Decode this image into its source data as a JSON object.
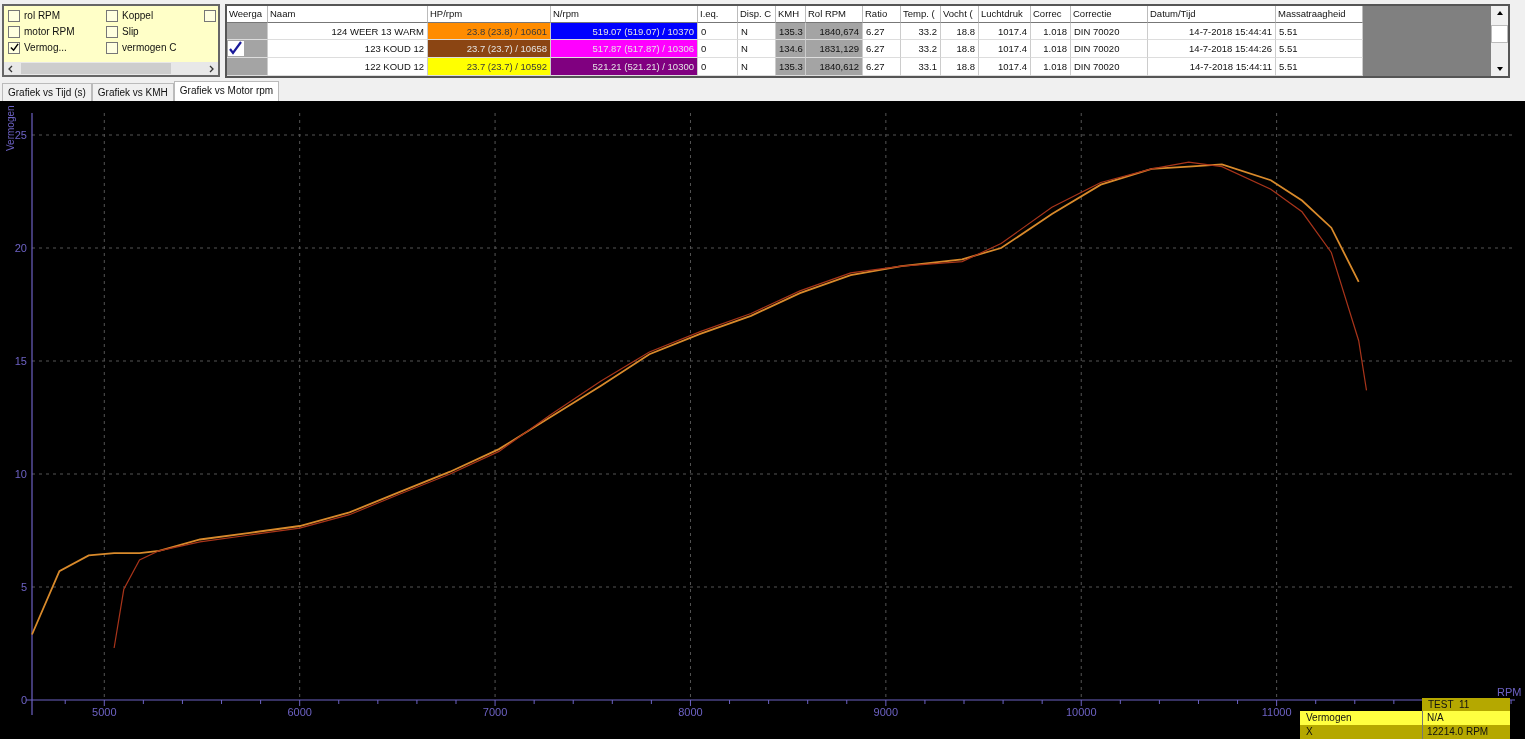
{
  "curve_panel": {
    "columns": [
      [
        {
          "label": "rol RPM",
          "checked": false
        },
        {
          "label": "motor RPM",
          "checked": false
        },
        {
          "label": "Vermog...",
          "checked": true
        }
      ],
      [
        {
          "label": "Koppel",
          "checked": false
        },
        {
          "label": "Slip",
          "checked": false
        },
        {
          "label": "vermogen C",
          "checked": false
        }
      ],
      [
        {
          "checked": false
        }
      ]
    ]
  },
  "runs_table": {
    "columns": [
      "Weerga",
      "Naam",
      "HP/rpm",
      "N/rpm",
      "I.eq.",
      "Disp. C",
      "KMH",
      "Rol RPM",
      "Ratio",
      "Temp. (",
      "Vocht (",
      "Luchtdruk",
      "Correc",
      "Correctie",
      "Datum/Tijd",
      "Massatraagheid"
    ],
    "rows": [
      {
        "checked": false,
        "naam": "124 WEER 13 WARM",
        "hp": {
          "text": "23.8 (23.8) / 10601",
          "color": "#ff8c00"
        },
        "nrpm": {
          "text": "519.07 (519.07) / 10370",
          "color": "#0000ff"
        },
        "ieq": "0",
        "disp": "N",
        "kmh": "135.3",
        "rol_rpm": "1840,674",
        "ratio": "6.27",
        "temp": "33.2",
        "vocht": "18.8",
        "luchtdruk": "1017.4",
        "correc": "1.018",
        "correctie": "DIN 70020",
        "datum": "14-7-2018 15:44:41",
        "massa": "5.51"
      },
      {
        "checked": true,
        "naam": "123 KOUD 12",
        "hp": {
          "text": "23.7 (23.7) / 10658",
          "color": "#8b4513"
        },
        "nrpm": {
          "text": "517.87 (517.87) / 10306",
          "color": "#ff00ff"
        },
        "ieq": "0",
        "disp": "N",
        "kmh": "134.6",
        "rol_rpm": "1831,129",
        "ratio": "6.27",
        "temp": "33.2",
        "vocht": "18.8",
        "luchtdruk": "1017.4",
        "correc": "1.018",
        "correctie": "DIN 70020",
        "datum": "14-7-2018 15:44:26",
        "massa": "5.51"
      },
      {
        "checked": false,
        "naam": "122 KOUD 12",
        "hp": {
          "text": "23.7 (23.7) / 10592",
          "color": "#ffff00"
        },
        "nrpm": {
          "text": "521.21 (521.21) / 10300",
          "color": "#800080"
        },
        "ieq": "0",
        "disp": "N",
        "kmh": "135.3",
        "rol_rpm": "1840,612",
        "ratio": "6.27",
        "temp": "33.1",
        "vocht": "18.8",
        "luchtdruk": "1017.4",
        "correc": "1.018",
        "correctie": "DIN 70020",
        "datum": "14-7-2018 15:44:11",
        "massa": "5.51"
      }
    ]
  },
  "tabs": [
    {
      "label": "Grafiek vs Tijd (s)",
      "selected": false
    },
    {
      "label": "Grafiek vs KMH",
      "selected": false
    },
    {
      "label": "Grafiek vs Motor rpm",
      "selected": true
    }
  ],
  "chart_data": {
    "type": "line",
    "grid": true,
    "xlabel": "RPM",
    "ylabel": "Vermogen",
    "xlim": [
      4630,
      12220
    ],
    "ylim": [
      0,
      26
    ],
    "xticks": [
      5000,
      6000,
      7000,
      8000,
      9000,
      10000,
      11000
    ],
    "yticks": [
      0,
      5,
      10,
      15,
      20,
      25
    ],
    "x": [
      4630,
      4770,
      4920,
      5050,
      5100,
      5180,
      5280,
      5490,
      5745,
      6000,
      6255,
      6510,
      6770,
      7020,
      7280,
      7540,
      7790,
      8050,
      8310,
      8560,
      8820,
      9080,
      9390,
      9590,
      9850,
      10100,
      10360,
      10550,
      10720,
      10970,
      11130,
      11280,
      11420,
      11460
    ],
    "series": [
      {
        "color": "#d98a2b",
        "values": [
          2.9,
          5.7,
          6.4,
          6.5,
          6.5,
          6.5,
          6.6,
          7.1,
          7.4,
          7.7,
          8.3,
          9.2,
          10.1,
          11.1,
          12.5,
          13.9,
          15.3,
          16.2,
          17.0,
          18.0,
          18.8,
          19.2,
          19.5,
          20.0,
          21.5,
          22.8,
          23.5,
          23.6,
          23.7,
          23.0,
          22.1,
          20.9,
          18.5,
          null
        ]
      },
      {
        "color": "#a8341a",
        "values": [
          null,
          null,
          null,
          2.3,
          4.9,
          6.2,
          6.6,
          7.0,
          7.3,
          7.6,
          8.2,
          9.1,
          10.0,
          11.0,
          12.6,
          14.1,
          15.4,
          16.3,
          17.1,
          18.1,
          18.9,
          19.2,
          19.4,
          20.2,
          21.8,
          22.9,
          23.5,
          23.8,
          23.6,
          22.6,
          21.6,
          19.8,
          15.9,
          13.7
        ]
      }
    ]
  },
  "cursor_box": {
    "title": "TEST  11",
    "rows": [
      {
        "label": "Vermogen",
        "value": "N/A",
        "kind": "highlight"
      },
      {
        "label": "X",
        "value": "12214.0 RPM",
        "kind": "plain"
      }
    ]
  }
}
